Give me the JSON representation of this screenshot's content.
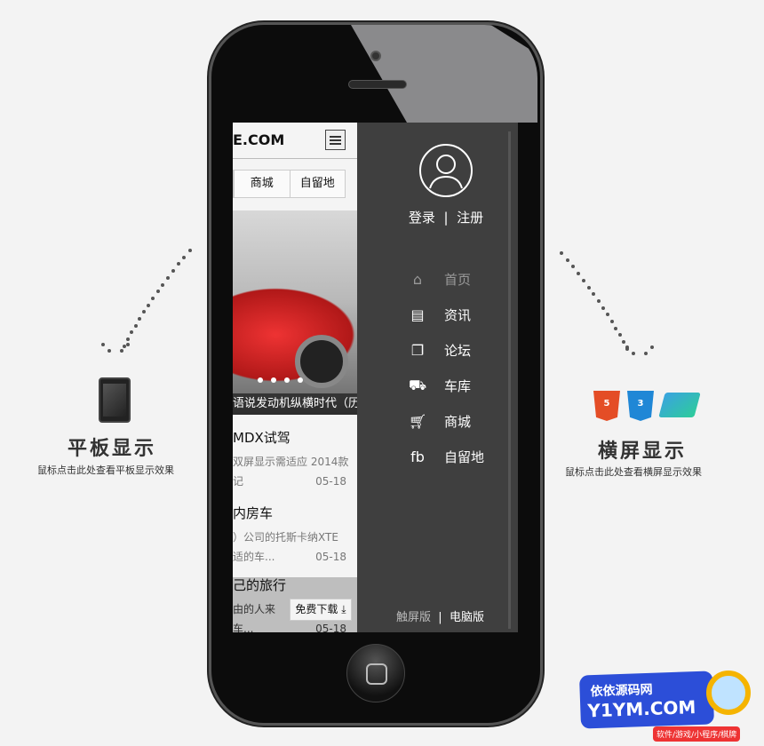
{
  "web": {
    "logo": "E.COM",
    "nav": [
      "商城",
      "自留地"
    ],
    "slide_caption": "语说发动机纵横时代（历",
    "slide_count": 4,
    "articles": [
      {
        "title": "MDX试驾",
        "desc": "双屏显示需适应 2014款",
        "desc2": "记",
        "date": "05-18"
      },
      {
        "title": "内房车",
        "desc": "）公司的托斯卡纳XTE",
        "desc2": "适的车...",
        "date": "05-18"
      },
      {
        "title": "己的旅行",
        "desc": "由的人来",
        "desc2": "车...",
        "date": "05-18"
      }
    ],
    "download": "免费下载"
  },
  "sidemenu": {
    "login": "登录",
    "register": "注册",
    "items": [
      {
        "icon": "home-icon",
        "label": "首页"
      },
      {
        "icon": "news-icon",
        "label": "资讯"
      },
      {
        "icon": "forum-icon",
        "label": "论坛"
      },
      {
        "icon": "car-icon",
        "label": "车库"
      },
      {
        "icon": "cart-icon",
        "label": "商城"
      },
      {
        "icon": "fb-icon",
        "label": "自留地"
      }
    ],
    "touch": "触屏版",
    "pc": "电脑版"
  },
  "left_promo": {
    "title": "平板显示",
    "subtitle": "鼠标点击此处查看平板显示效果"
  },
  "right_promo": {
    "title": "横屏显示",
    "subtitle": "鼠标点击此处查看横屏显示效果",
    "badges": [
      "5",
      "3"
    ]
  },
  "watermark": {
    "name": "依依源码网",
    "domain": "Y1YM.COM",
    "tags": "软件/游戏/小程序/棋牌"
  }
}
